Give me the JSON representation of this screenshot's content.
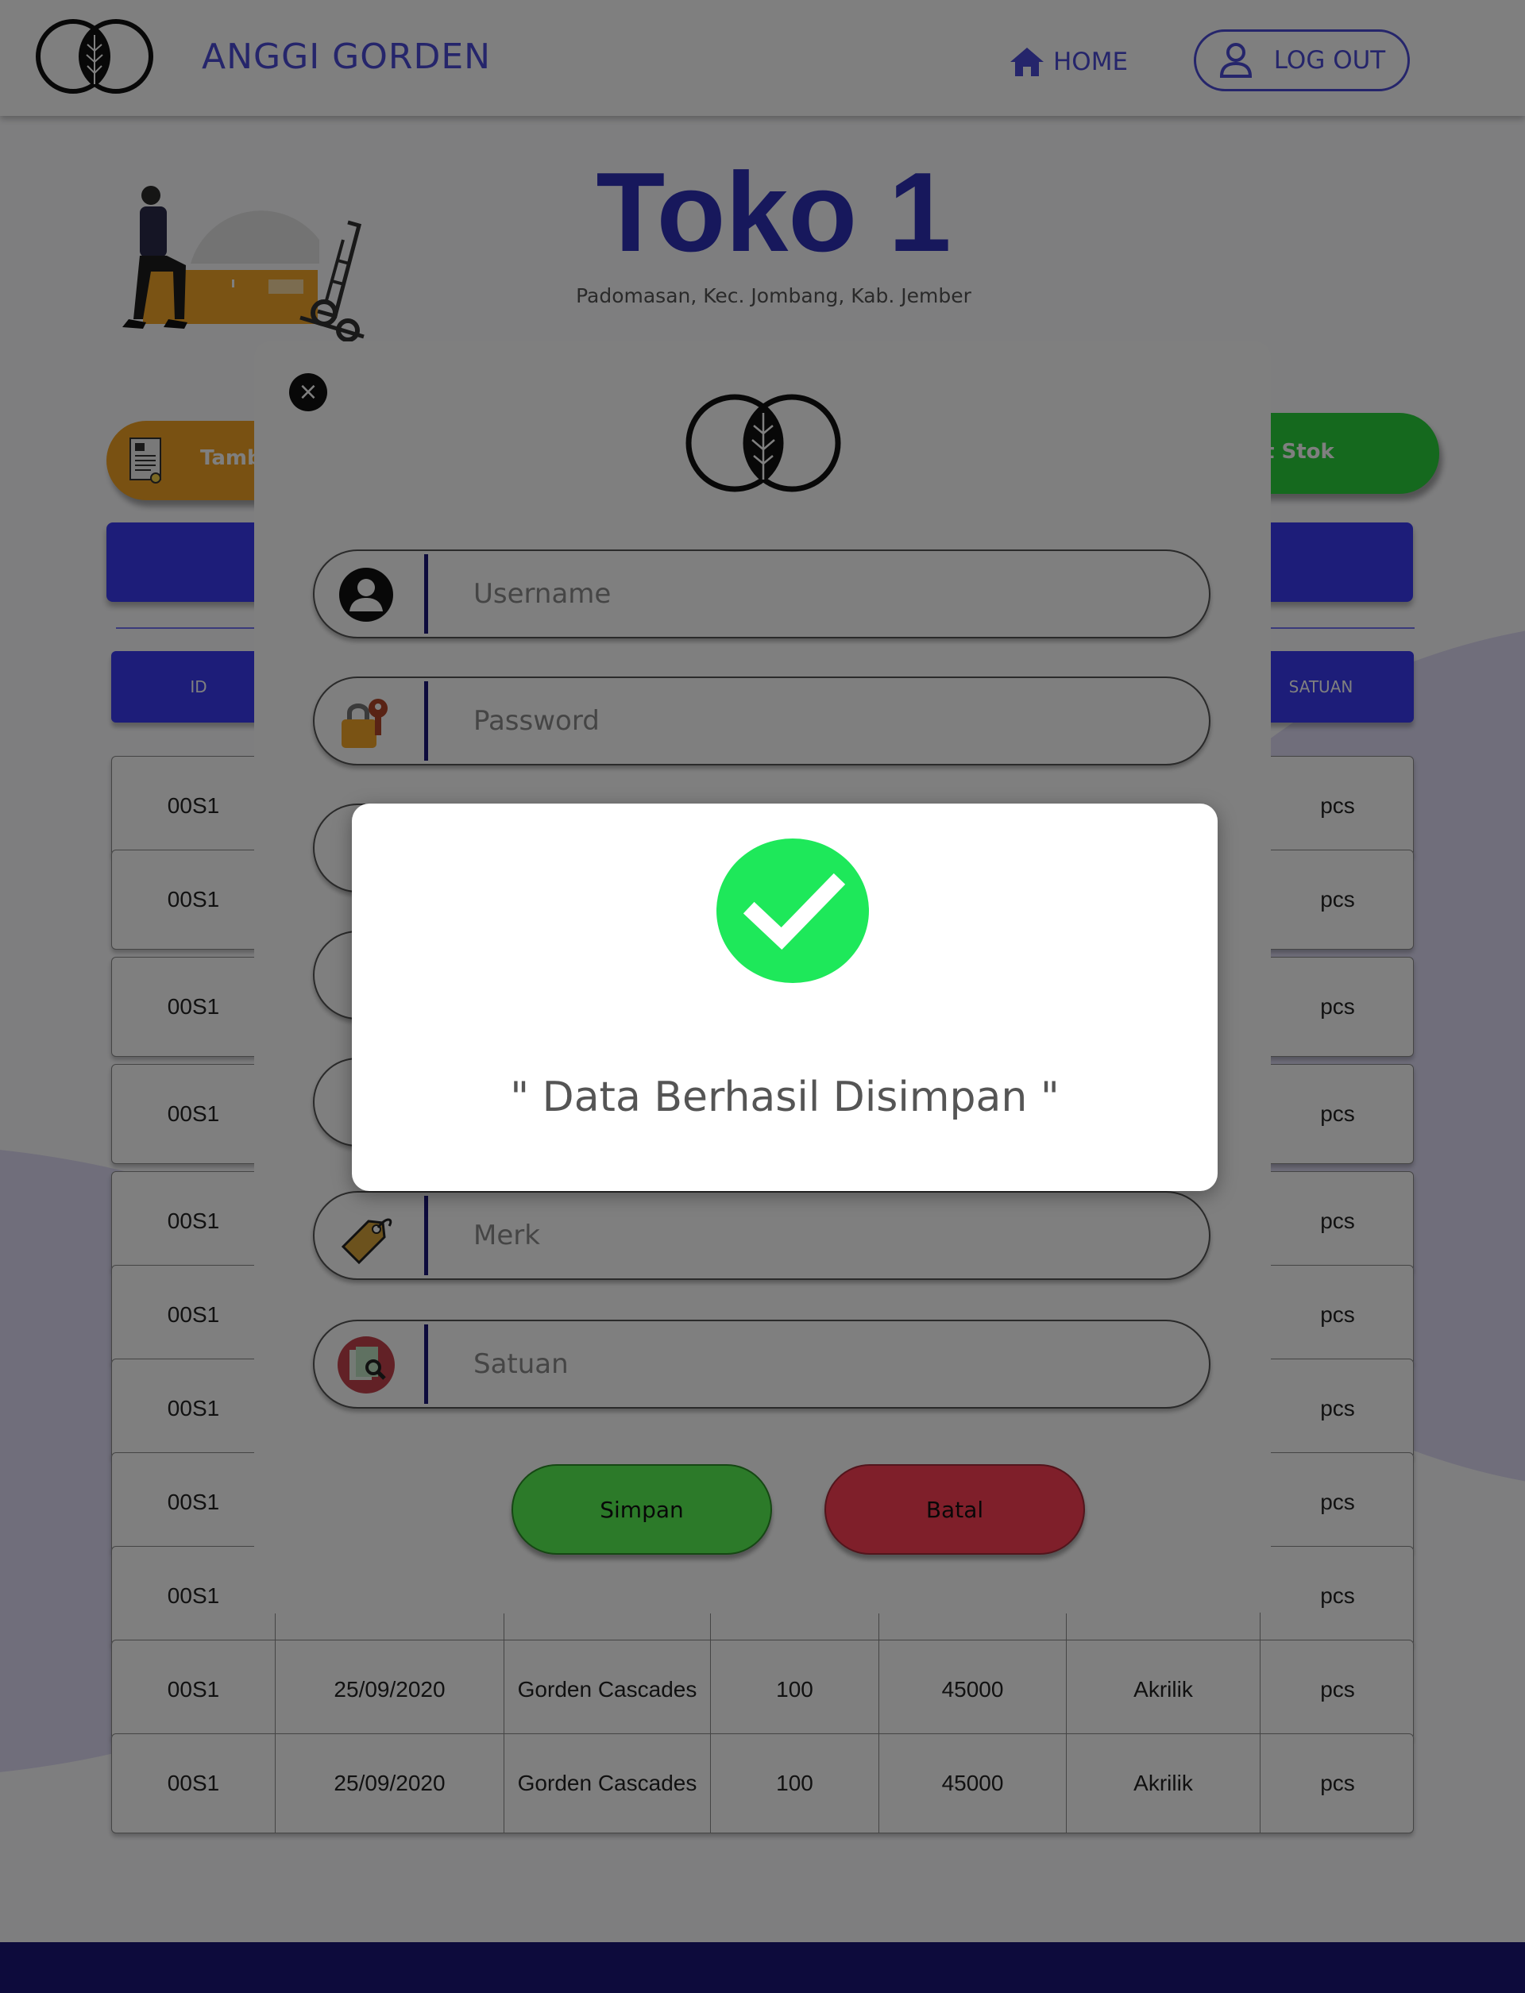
{
  "header": {
    "brand": "ANGGI GORDEN",
    "home_label": "HOME",
    "logout_label": "LOG OUT"
  },
  "store": {
    "title": "Toko 1",
    "address": "Padomasan, Kec. Jombang, Kab. Jember"
  },
  "actions": {
    "add_label": "Tamba",
    "stock_label": "t Stok"
  },
  "table": {
    "columns": [
      "ID",
      "SATUAN"
    ],
    "rows": [
      {
        "id": "00S1",
        "satuan": "pcs"
      },
      {
        "id": "00S1",
        "satuan": "pcs"
      },
      {
        "id": "00S1",
        "satuan": "pcs"
      },
      {
        "id": "00S1",
        "satuan": "pcs"
      },
      {
        "id": "00S1",
        "satuan": "pcs"
      },
      {
        "id": "00S1",
        "satuan": "pcs"
      },
      {
        "id": "00S1",
        "satuan": "pcs"
      },
      {
        "id": "00S1",
        "satuan": "pcs"
      },
      {
        "id": "00S1",
        "satuan": "pcs"
      },
      {
        "id": "00S1",
        "date": "25/09/2020",
        "name": "Gorden Cascades",
        "qty": "100",
        "price": "45000",
        "merk": "Akrilik",
        "satuan": "pcs"
      },
      {
        "id": "00S1",
        "date": "25/09/2020",
        "name": "Gorden Cascades",
        "qty": "100",
        "price": "45000",
        "merk": "Akrilik",
        "satuan": "pcs"
      }
    ]
  },
  "form": {
    "username_placeholder": "Username",
    "password_placeholder": "Password",
    "merk_placeholder": "Merk",
    "satuan_placeholder": "Satuan",
    "save_label": "Simpan",
    "cancel_label": "Batal",
    "close_symbol": "×"
  },
  "dialog": {
    "message": "\" Data Berhasil Disimpan \""
  },
  "colors": {
    "brand": "#4a4ad6",
    "table_header": "#3a3bf2",
    "success": "#1ee85a",
    "save": "#58f552",
    "cancel": "#ff3e55",
    "footer": "#1a1678"
  }
}
